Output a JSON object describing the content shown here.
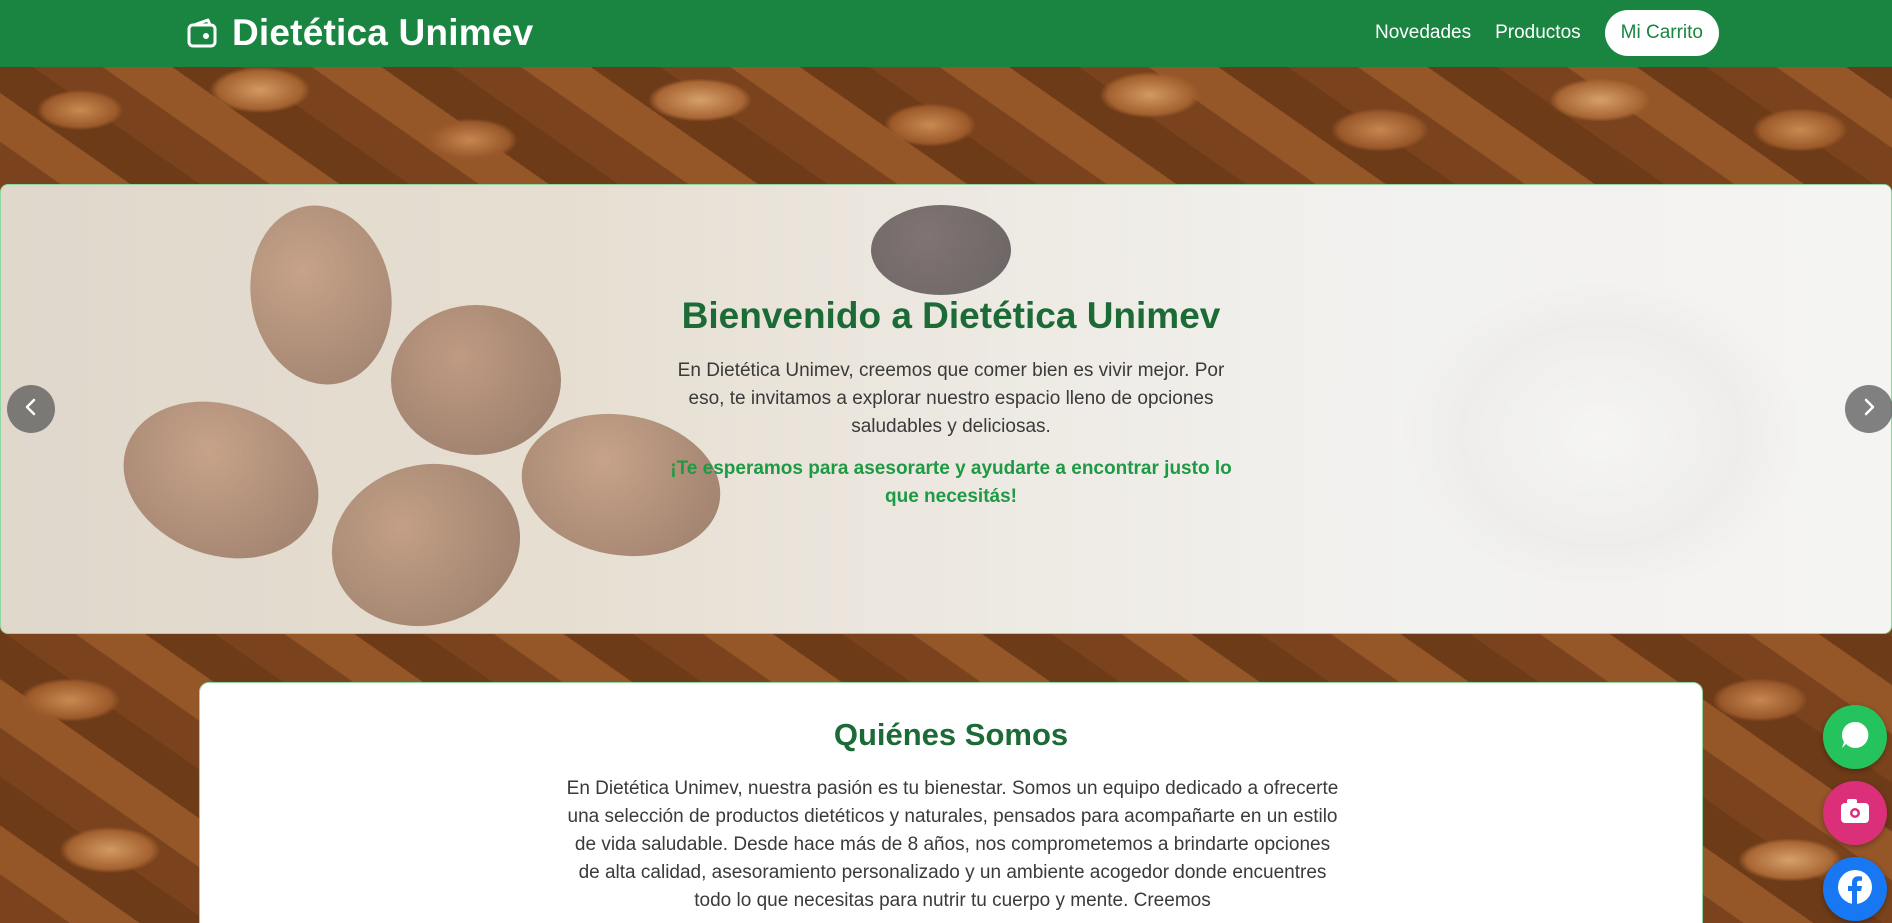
{
  "navbar": {
    "brand": "Dietética Unimev",
    "links": [
      "Novedades",
      "Productos"
    ],
    "cart_label": "Mi Carrito",
    "brand_color": "#198541"
  },
  "carousel": {
    "title": "Bienvenido a Dietética Unimev",
    "text": "En Dietética Unimev, creemos que comer bien es vivir mejor. Por eso, te invitamos a explorar nuestro espacio lleno de opciones saludables y deliciosas.",
    "cta": "¡Te esperamos para asesorarte y ayudarte a encontrar justo lo que necesitás!",
    "prev_icon": "chevron-left-icon",
    "next_icon": "chevron-right-icon",
    "slides_count": 3,
    "active_slide": 1
  },
  "about": {
    "title": "Quiénes Somos",
    "text": "En Dietética Unimev, nuestra pasión es tu bienestar. Somos un equipo dedicado a ofrecerte una selección de productos dietéticos y naturales, pensados para acompañarte en un estilo de vida saludable. Desde hace más de 8 años, nos comprometemos a brindarte opciones de alta calidad, asesoramiento personalizado y un ambiente acogedor donde encuentres todo lo que necesitas para nutrir tu cuerpo y mente. Creemos"
  },
  "floating": {
    "whatsapp_icon": "whatsapp-icon",
    "instagram_icon": "instagram-icon",
    "facebook_icon": "facebook-icon",
    "whatsapp_color": "#25c35e",
    "instagram_color": "#dc2f7a",
    "facebook_color": "#1877f2"
  }
}
